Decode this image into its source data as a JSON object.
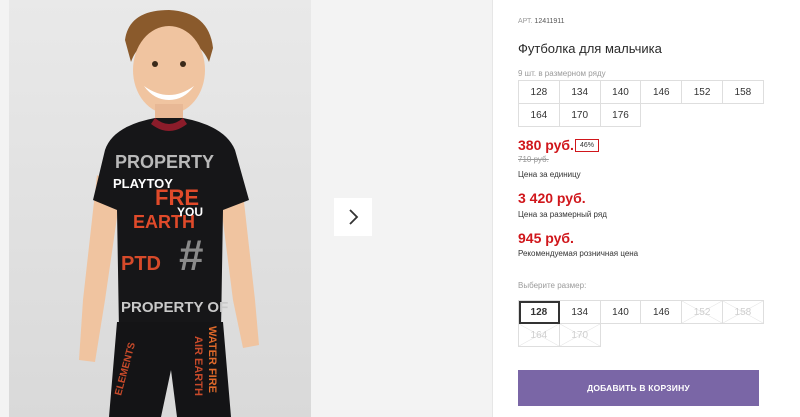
{
  "product": {
    "article_label": "АРТ.",
    "article_value": "12411911",
    "title": "Футболка для мальчика",
    "pack_note": "9 шт. в размерном ряду",
    "pack_sizes": [
      "128",
      "134",
      "140",
      "146",
      "152",
      "158",
      "164",
      "170",
      "176"
    ]
  },
  "pricing": {
    "unit_price": "380 руб.",
    "discount": "46%",
    "old_price": "710 руб.",
    "unit_note": "Цена за единицу",
    "pack_price": "3 420 руб.",
    "pack_note": "Цена за размерный ряд",
    "retail_price": "945 руб.",
    "retail_note": "Рекомендуемая розничная цена"
  },
  "size_picker": {
    "label": "Выберите размер:",
    "sizes": [
      {
        "label": "128",
        "state": "selected"
      },
      {
        "label": "134",
        "state": "available"
      },
      {
        "label": "140",
        "state": "available"
      },
      {
        "label": "146",
        "state": "available"
      },
      {
        "label": "152",
        "state": "unavailable"
      },
      {
        "label": "158",
        "state": "unavailable"
      },
      {
        "label": "164",
        "state": "unavailable"
      },
      {
        "label": "170",
        "state": "unavailable"
      }
    ]
  },
  "actions": {
    "add_to_cart": "ДОБАВИТЬ В КОРЗИНУ"
  },
  "gallery": {
    "next_icon": "chevron-right-icon",
    "shirt_print": [
      "PROPERTY",
      "PLAYTOY",
      "FRE",
      "EARTH",
      "YOU",
      "#",
      "PTD",
      "PROPERTY OF",
      "AIR EARTH",
      "WATER FIRE",
      "ELEMENTS"
    ]
  },
  "colors": {
    "price_red": "#d0161b",
    "button_purple": "#7a66a6",
    "border": "#dedede"
  }
}
